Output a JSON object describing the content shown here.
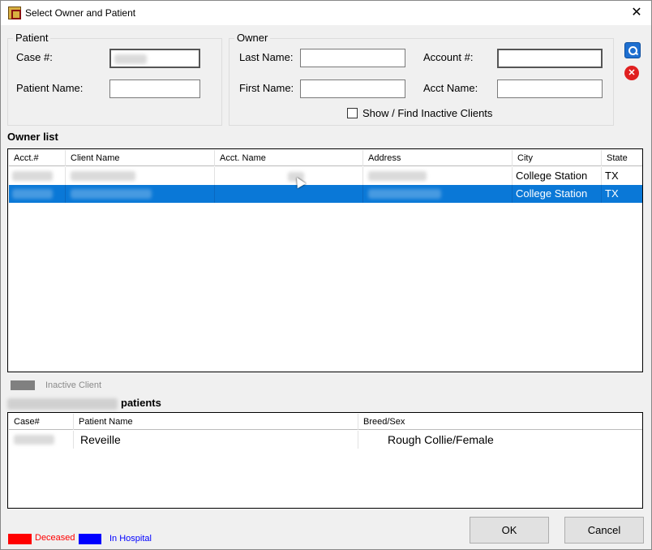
{
  "window": {
    "title": "Select Owner and Patient",
    "close": "✕"
  },
  "patient_group": {
    "title": "Patient",
    "case_label": "Case #:",
    "name_label": "Patient Name:",
    "case_value": "",
    "name_value": ""
  },
  "owner_group": {
    "title": "Owner",
    "last_name_label": "Last Name:",
    "first_name_label": "First Name:",
    "account_label": "Account #:",
    "acct_name_label": "Acct Name:",
    "show_inactive_label": "Show / Find Inactive Clients",
    "show_inactive_checked": false
  },
  "owner_list": {
    "title": "Owner list",
    "columns": [
      "Acct.#",
      "Client Name",
      "Acct. Name",
      "Address",
      "City",
      "State"
    ],
    "rows": [
      {
        "acct": "",
        "client": "",
        "acct_name": "",
        "address": "",
        "city": "College Station",
        "state": "TX",
        "selected": false
      },
      {
        "acct": "",
        "client": "",
        "acct_name": "",
        "address": "",
        "city": "College Station",
        "state": "TX",
        "selected": true
      }
    ]
  },
  "legend_top": {
    "inactive_label": "Inactive Client",
    "inactive_color": "#808080"
  },
  "patients": {
    "title_suffix": "patients",
    "columns": [
      "Case#",
      "Patient Name",
      "Breed/Sex"
    ],
    "rows": [
      {
        "case": "",
        "name": "Reveille",
        "breed_sex": "Rough Collie/Female"
      }
    ]
  },
  "legend_bottom": {
    "deceased_label": "Deceased",
    "deceased_color": "#ff0000",
    "in_hospital_label": "In Hospital",
    "in_hospital_color": "#0000ff"
  },
  "buttons": {
    "ok": "OK",
    "cancel": "Cancel"
  },
  "icons": {
    "search": "search-icon",
    "clear": "cancel-icon"
  },
  "colors": {
    "selection": "#0a78d7"
  }
}
